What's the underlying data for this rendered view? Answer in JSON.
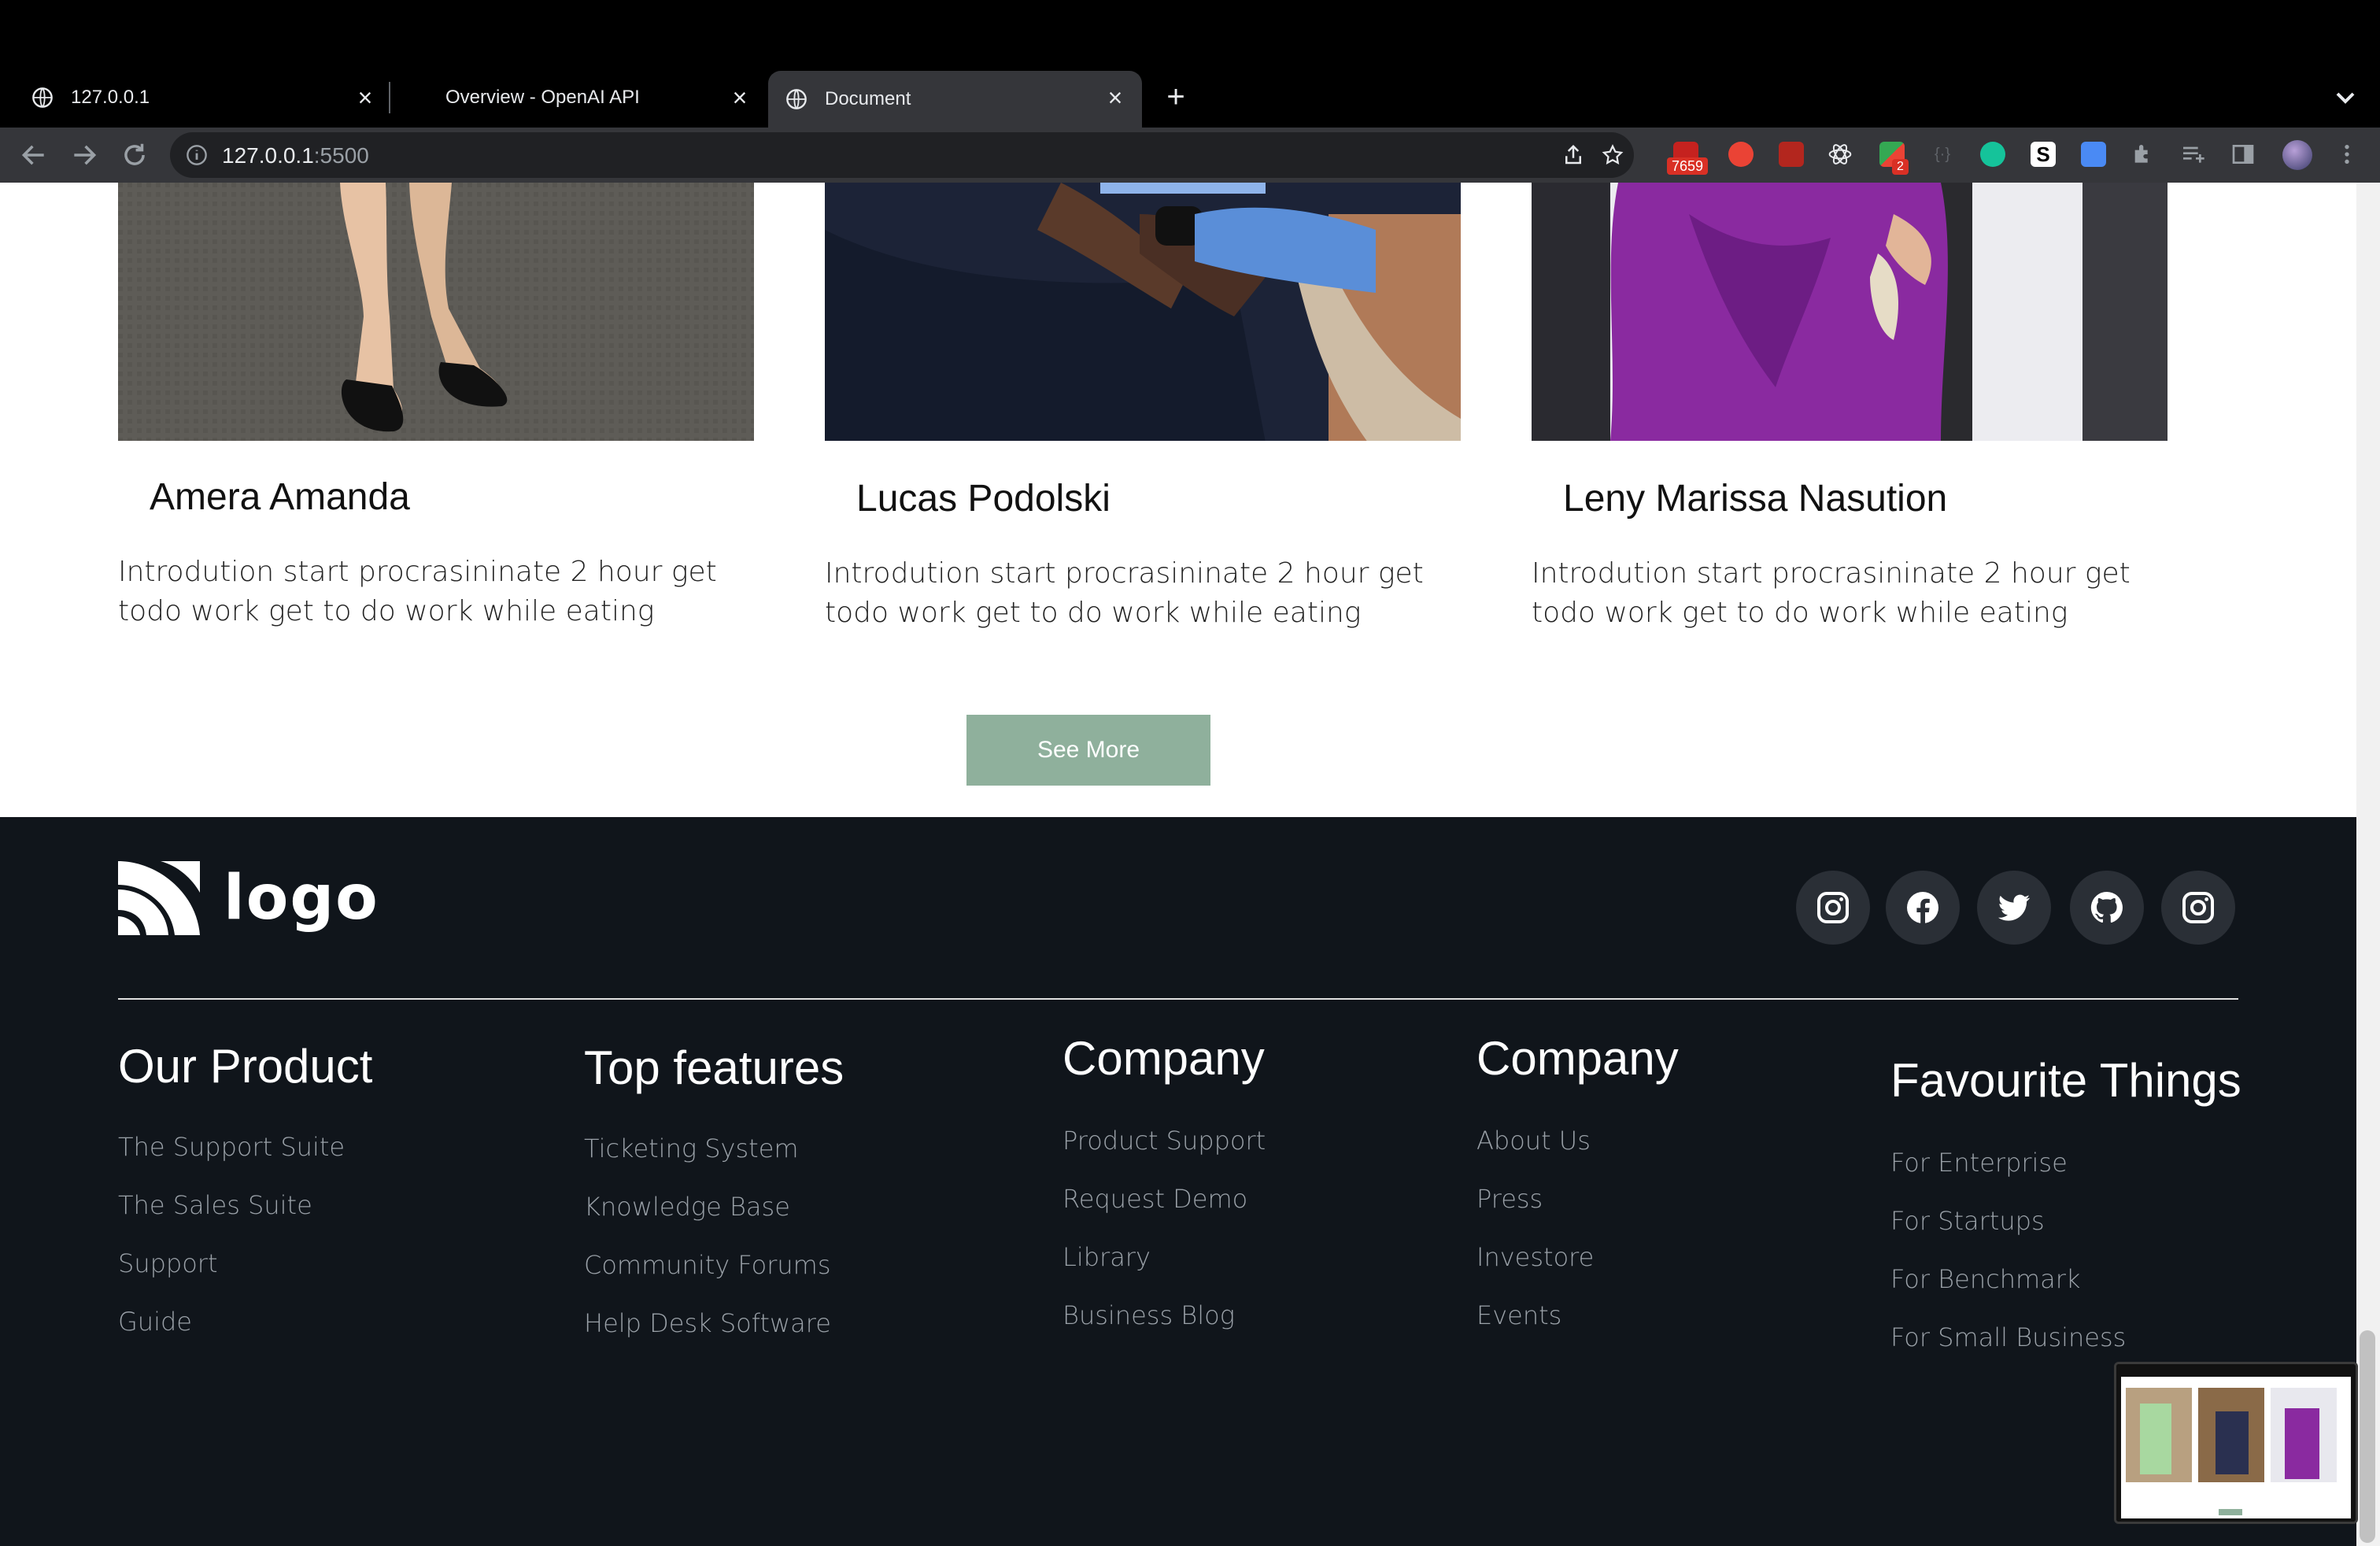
{
  "browser": {
    "tabs": [
      {
        "title": "127.0.0.1"
      },
      {
        "title": "Overview - OpenAI API"
      },
      {
        "title": "Document"
      }
    ],
    "url_host": "127.0.0.1",
    "url_port": ":5500",
    "ext_badges": {
      "mail": "7659",
      "notes": "2"
    }
  },
  "cards": [
    {
      "name": "Amera Amanda",
      "description": "Introdution start procrasininate 2 hour get todo work get to do work while eating"
    },
    {
      "name": "Lucas Podolski",
      "description": "Introdution start procrasininate 2 hour get todo work get to do work while eating"
    },
    {
      "name": "Leny Marissa Nasution",
      "description": "Introdution start procrasininate 2 hour get todo work get to do work while eating"
    }
  ],
  "see_more_label": "See More",
  "footer": {
    "logo_text": "logo",
    "social_icons": [
      "instagram-icon",
      "facebook-icon",
      "twitter-icon",
      "github-icon",
      "instagram-icon"
    ],
    "columns": [
      {
        "title": "Our Product",
        "links": [
          "The Support Suite",
          "The Sales Suite",
          "Support",
          "Guide"
        ]
      },
      {
        "title": "Top features",
        "links": [
          "Ticketing System",
          "Knowledge Base",
          "Community Forums",
          "Help Desk Software"
        ]
      },
      {
        "title": "Company",
        "links": [
          "Product Support",
          "Request Demo",
          "Library",
          "Business Blog"
        ]
      },
      {
        "title": "Company",
        "links": [
          "About Us",
          "Press",
          "Investore",
          "Events"
        ]
      },
      {
        "title": "Favourite Things",
        "links": [
          "For Enterprise",
          "For Startups",
          "For Benchmark",
          "For Small Business"
        ]
      }
    ]
  },
  "colors": {
    "footer_bg": "#10151b",
    "button_bg": "#8fb09c",
    "browser_chrome": "#35363a"
  }
}
